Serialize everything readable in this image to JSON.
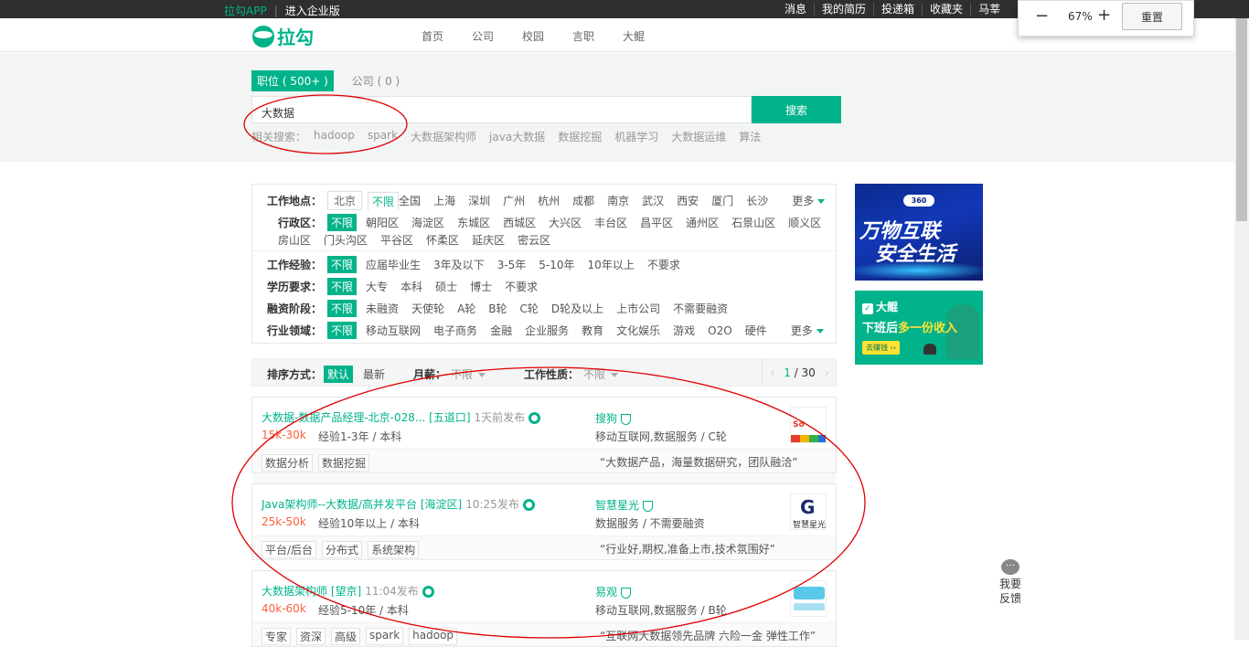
{
  "topbar": {
    "app": "拉勾APP",
    "enterprise": "进入企业版",
    "links": [
      "消息",
      "我的简历",
      "投递箱",
      "收藏夹",
      "马莘"
    ]
  },
  "zoom": {
    "minus": "−",
    "value": "67%",
    "plus": "+",
    "reset": "重置"
  },
  "brand": {
    "name": "拉勾"
  },
  "nav": [
    "首页",
    "公司",
    "校园",
    "言职",
    "大鲲"
  ],
  "search": {
    "tab_jobs": "职位 ( 500+ )",
    "tab_companies": "公司 ( 0 )",
    "query": "大数据",
    "button": "搜索",
    "related_label": "相关搜索：",
    "related": [
      "hadoop",
      "spark",
      "大数据架构师",
      "java大数据",
      "数据挖掘",
      "机器学习",
      "大数据运维",
      "算法"
    ]
  },
  "filters": {
    "location": {
      "label": "工作地点：",
      "city": "北京",
      "unlimited": "不限",
      "cities": [
        "全国",
        "上海",
        "深圳",
        "广州",
        "杭州",
        "成都",
        "南京",
        "武汉",
        "西安",
        "厦门",
        "长沙"
      ],
      "more": "更多"
    },
    "district": {
      "label": "行政区：",
      "unlimited": "不限",
      "items_row1": [
        "朝阳区",
        "海淀区",
        "东城区",
        "西城区",
        "大兴区",
        "丰台区",
        "昌平区",
        "通州区",
        "石景山区",
        "顺义区"
      ],
      "items_row2": [
        "房山区",
        "门头沟区",
        "平谷区",
        "怀柔区",
        "延庆区",
        "密云区"
      ]
    },
    "experience": {
      "label": "工作经验：",
      "unlimited": "不限",
      "items": [
        "应届毕业生",
        "3年及以下",
        "3-5年",
        "5-10年",
        "10年以上",
        "不要求"
      ]
    },
    "education": {
      "label": "学历要求：",
      "unlimited": "不限",
      "items": [
        "大专",
        "本科",
        "硕士",
        "博士",
        "不要求"
      ]
    },
    "finance": {
      "label": "融资阶段：",
      "unlimited": "不限",
      "items": [
        "未融资",
        "天使轮",
        "A轮",
        "B轮",
        "C轮",
        "D轮及以上",
        "上市公司",
        "不需要融资"
      ]
    },
    "industry": {
      "label": "行业领域：",
      "unlimited": "不限",
      "items": [
        "移动互联网",
        "电子商务",
        "金融",
        "企业服务",
        "教育",
        "文化娱乐",
        "游戏",
        "O2O",
        "硬件"
      ],
      "more": "更多"
    }
  },
  "sort": {
    "label": "排序方式：",
    "default": "默认",
    "newest": "最新",
    "salary_label": "月薪：",
    "salary_value": "不限",
    "jobtype_label": "工作性质：",
    "jobtype_value": "不限",
    "page": "1",
    "total": "/ 30"
  },
  "jobs": [
    {
      "title": "大数据-数据产品经理-北京-028... [五道口]",
      "time": "1天前发布",
      "salary": "15k-30k",
      "req": "经验1-3年 / 本科",
      "company": "搜狗",
      "company_info": "移动互联网,数据服务 / C轮",
      "tags": [
        "数据分析",
        "数据挖掘"
      ],
      "slogan": "“大数据产品，海量数据研究，团队融洽”"
    },
    {
      "title": "Java架构师--大数据/高并发平台 [海淀区]",
      "time": "10:25发布",
      "salary": "25k-50k",
      "req": "经验10年以上 / 本科",
      "company": "智慧星光",
      "company_info": "数据服务 / 不需要融资",
      "tags": [
        "平台/后台",
        "分布式",
        "系统架构"
      ],
      "slogan": "“行业好,期权,准备上市,技术氛围好”",
      "logo_text": "智慧星光"
    },
    {
      "title": "大数据架构师 [望京]",
      "time": "11:04发布",
      "salary": "40k-60k",
      "req": "经验5-10年 / 本科",
      "company": "易观",
      "company_info": "移动互联网,数据服务 / B轮",
      "tags": [
        "专家",
        "资深",
        "高级",
        "spark",
        "hadoop"
      ],
      "slogan": "“互联网大数据领先品牌 六险一金 弹性工作”"
    }
  ],
  "ads": {
    "ad1_line1": "万物互联",
    "ad1_line2": "安全生活",
    "ad1_badge": "360",
    "ad2_brand": "大鲲",
    "ad2_line_a": "下班后",
    "ad2_line_b": "多一份收入",
    "ad2_btn": "去赚钱 ››"
  },
  "feedback": "我要反馈",
  "colors": {
    "accent": "#00b38a",
    "salary": "#fd5f39",
    "annotation": "#e00000"
  }
}
